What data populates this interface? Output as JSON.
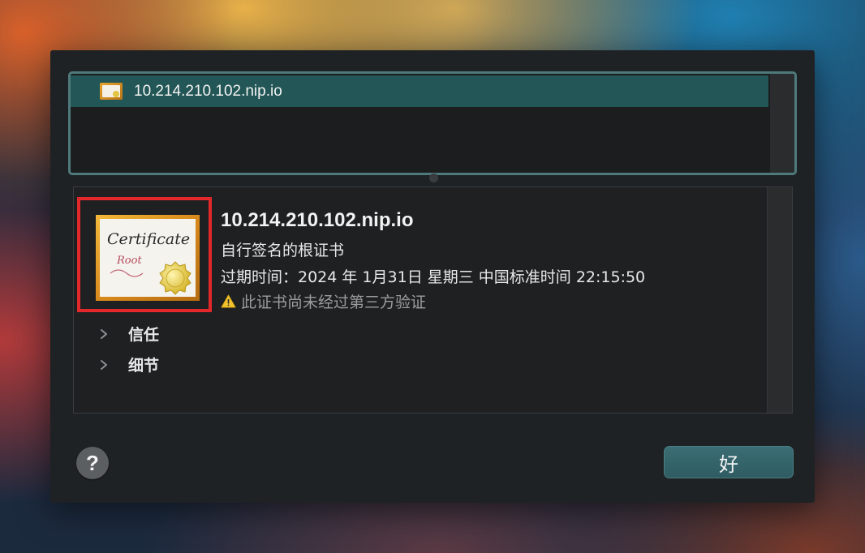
{
  "certificate_list": {
    "items": [
      {
        "name": "10.214.210.102.nip.io",
        "selected": true
      }
    ]
  },
  "certificate_detail": {
    "icon": "certificate-icon",
    "icon_text_line1": "Certificate",
    "icon_text_line2": "Root",
    "title": "10.214.210.102.nip.io",
    "subtitle": "自行签名的根证书",
    "expiry": "过期时间：2024 年 1月31日 星期三 中国标准时间 22:15:50",
    "warning_icon": "warning-icon",
    "warning": "此证书尚未经过第三方验证",
    "sections": [
      {
        "label": "信任",
        "expanded": false
      },
      {
        "label": "细节",
        "expanded": false
      }
    ]
  },
  "buttons": {
    "help_label": "?",
    "ok_label": "好"
  },
  "colors": {
    "selection": "#235656",
    "focus_ring": "#4f7a7c",
    "highlight_box": "#e3282c",
    "ok_button": "#356369",
    "warning_yellow": "#f2c230"
  }
}
